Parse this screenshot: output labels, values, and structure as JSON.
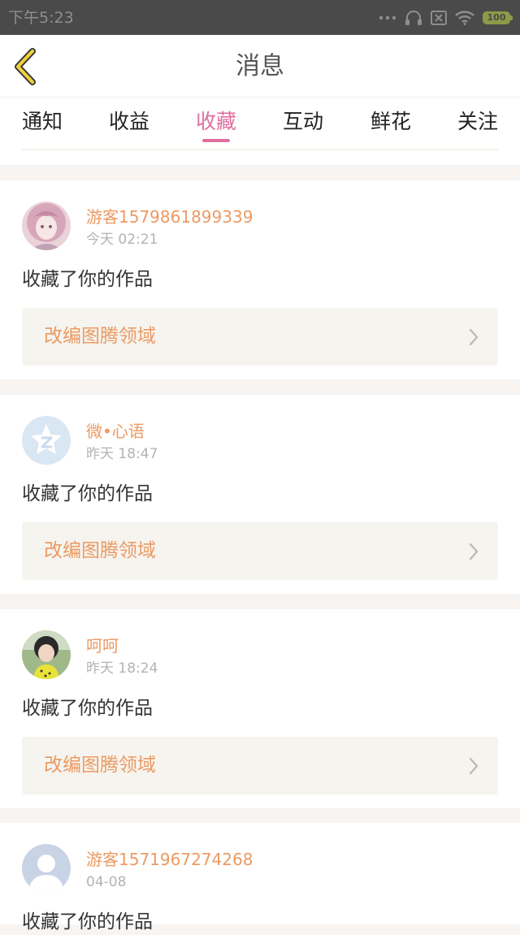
{
  "status_bar": {
    "time": "下午5:23",
    "battery": "100",
    "icons": [
      "more-dots-icon",
      "headset-icon",
      "sim-off-icon",
      "wifi-icon",
      "battery-icon"
    ]
  },
  "header": {
    "title": "消息",
    "back_icon": "back-chevron-icon"
  },
  "tabs": [
    {
      "label": "通知",
      "active": false
    },
    {
      "label": "收益",
      "active": false
    },
    {
      "label": "收藏",
      "active": true
    },
    {
      "label": "互动",
      "active": false
    },
    {
      "label": "鲜花",
      "active": false
    },
    {
      "label": "关注",
      "active": false
    }
  ],
  "messages": [
    {
      "username": "游客1579861899339",
      "time": "今天 02:21",
      "action": "收藏了你的作品",
      "work": "改编图腾领域",
      "avatar": "anime-girl-avatar"
    },
    {
      "username": "微•心语",
      "time": "昨天 18:47",
      "action": "收藏了你的作品",
      "work": "改编图腾领域",
      "avatar": "qzone-star-avatar"
    },
    {
      "username": "呵呵",
      "time": "昨天 18:24",
      "action": "收藏了你的作品",
      "work": "改编图腾领域",
      "avatar": "child-photo-avatar"
    },
    {
      "username": "游客1571967274268",
      "time": "04-08",
      "action": "收藏了你的作品",
      "work": "",
      "avatar": "default-user-avatar"
    }
  ],
  "colors": {
    "accent": "#e06fa0",
    "username": "#ec9a63",
    "work_title": "#ec9a63",
    "background": "#f7f4f2",
    "status_bar": "#4a4a4a"
  }
}
